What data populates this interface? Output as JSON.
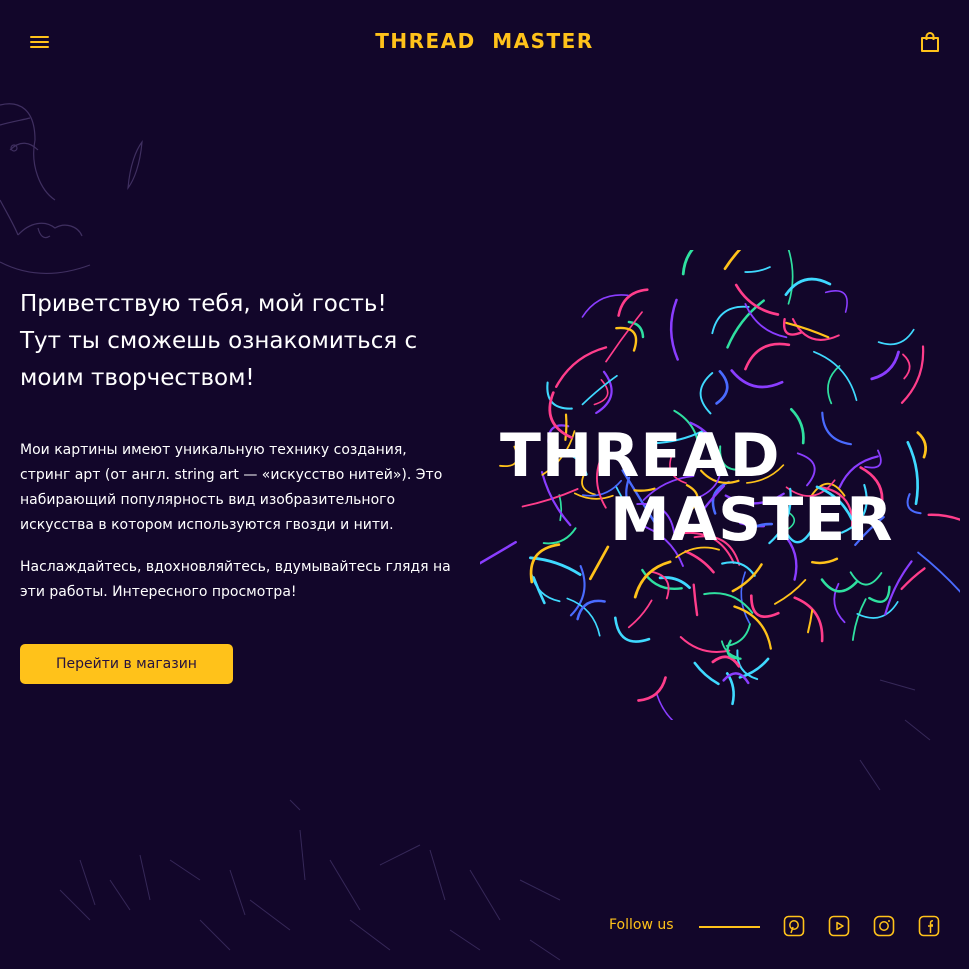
{
  "header": {
    "logo": "THREAD  MASTER"
  },
  "hero": {
    "title_lines": [
      "Приветствую тебя, мой гость!",
      "Тут ты сможешь ознакомиться с",
      "моим творчеством!"
    ],
    "paragraph1_lines": [
      "Мои картины имеют уникальную технику создания,",
      "стринг арт (от англ. string art — «искусство нитей»). Это",
      "набирающий популярность вид изобразительного",
      "искусства в котором используются гвозди и нити."
    ],
    "paragraph2_lines": [
      "Наслаждайтесь, вдохновляйтесь, вдумывайтесь глядя на",
      "эти работы. Интересного просмотра!"
    ],
    "shop_button": "Перейти в магазин"
  },
  "art": {
    "logo_line1": "THREAD",
    "logo_line2": "MASTER",
    "thread_colors": [
      "#ffc21a",
      "#ff3d8b",
      "#3fd9ff",
      "#2fe0a0",
      "#8a3dff",
      "#4a6bff"
    ]
  },
  "footer": {
    "follow_label": "Follow us",
    "socials": [
      "pinterest-icon",
      "youtube-icon",
      "instagram-icon",
      "facebook-icon"
    ]
  },
  "colors": {
    "background": "#12062a",
    "accent": "#ffc21a",
    "text": "#ffffff"
  }
}
